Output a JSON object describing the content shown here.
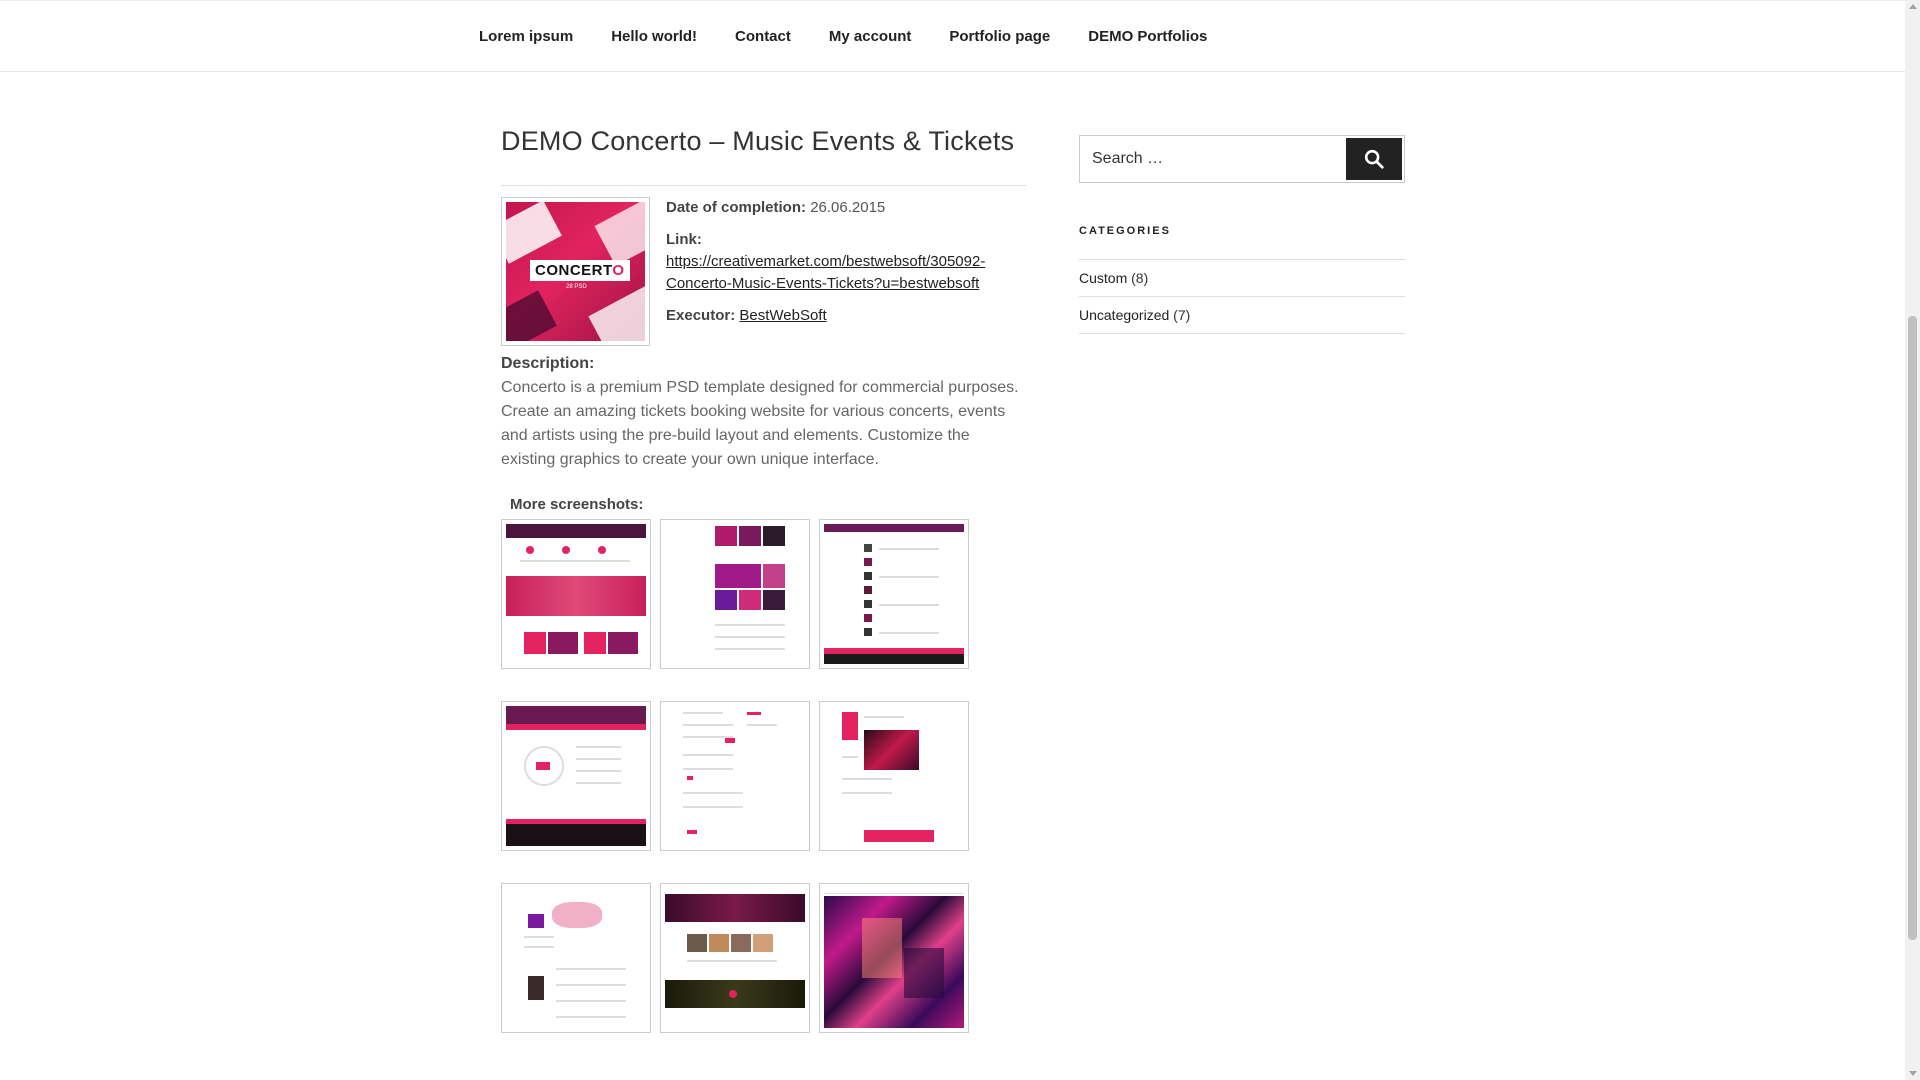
{
  "nav": {
    "items": [
      {
        "label": "Lorem ipsum"
      },
      {
        "label": "Hello world!"
      },
      {
        "label": "Contact"
      },
      {
        "label": "My account"
      },
      {
        "label": "Portfolio page"
      },
      {
        "label": "DEMO Portfolios"
      }
    ]
  },
  "post": {
    "title": "DEMO Concerto – Music Events & Tickets",
    "thumbnail": {
      "logo_main": "CONCERT",
      "logo_accent": "O",
      "subtitle": "28 PSD"
    },
    "date_label": "Date of completion:",
    "date_value": "26.06.2015",
    "link_label": "Link:",
    "link_url": "https://creativemarket.com/bestwebsoft/305092-Concerto-Music-Events-Tickets?u=bestwebsoft",
    "executor_label": "Executor:",
    "executor_value": "BestWebSoft",
    "description_label": "Description:",
    "description_p1": "Concerto is a premium PSD template designed for commercial purposes.",
    "description_p2": "Create an amazing tickets booking website for various concerts, events and artists using the pre-build layout and elements. Customize the existing graphics to create your own unique interface.",
    "more_label": "More screenshots:"
  },
  "sidebar": {
    "search_placeholder": "Search …",
    "search_icon": "search-icon",
    "categories_title": "CATEGORIES",
    "categories": [
      {
        "label": "Custom",
        "count": "(8)"
      },
      {
        "label": "Uncategorized",
        "count": "(7)"
      }
    ]
  },
  "colors": {
    "accent": "#e2235f",
    "dark": "#222222",
    "purple": "#5a1a4e"
  }
}
